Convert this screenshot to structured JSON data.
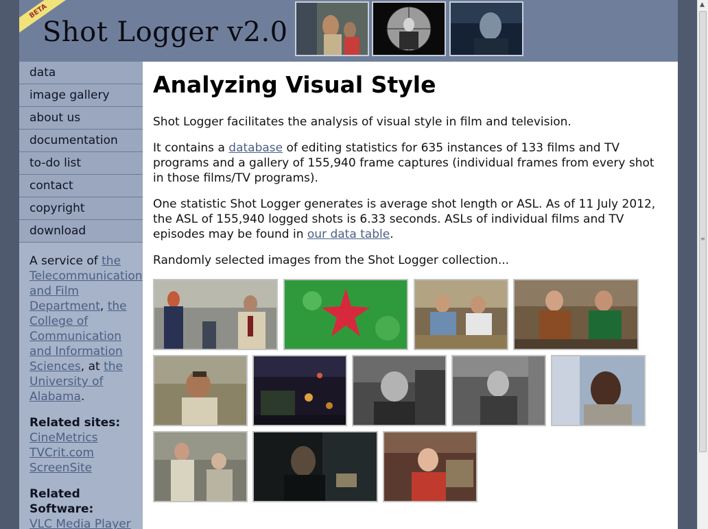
{
  "header": {
    "beta_label": "BETA",
    "logo_text": "Shot Logger v2.0"
  },
  "sidebar": {
    "nav": [
      {
        "label": "data"
      },
      {
        "label": "image gallery"
      },
      {
        "label": "about us"
      },
      {
        "label": "documentation"
      },
      {
        "label": "to-do list"
      },
      {
        "label": "contact"
      },
      {
        "label": "copyright"
      },
      {
        "label": "download"
      }
    ],
    "service": {
      "prefix": "A service of ",
      "link1": "the Telecommunication and Film Department",
      "sep1": ", ",
      "link2": "the College of Communication and Information Sciences",
      "sep2": ", at ",
      "link3": "the University of Alabama",
      "suffix": "."
    },
    "related_sites_heading": "Related sites:",
    "related_sites": [
      "CineMetrics",
      "TVCrit.com",
      "ScreenSite"
    ],
    "related_software_heading": "Related Software:",
    "related_software": [
      "VLC Media Player"
    ]
  },
  "main": {
    "title": "Analyzing Visual Style",
    "p1": "Shot Logger facilitates the analysis of visual style in film and television.",
    "p2": {
      "pre": "It contains a ",
      "link": "database",
      "post": " of editing statistics for 635 instances of 133 films and TV programs and a gallery of 155,940 frame captures (individual frames from every shot in those films/TV programs)."
    },
    "p3": {
      "pre": "One statistic Shot Logger generates is average shot length or ASL. As of 11 July 2012, the ASL of 155,940 logged shots is 6.33 seconds. ASLs of individual films and TV episodes may be found in ",
      "link": "our data table",
      "post": "."
    },
    "p4": "Randomly selected images from the Shot Logger collection..."
  },
  "colors": {
    "page_bg": "#6f7f9b",
    "sidebar_nav": "#9aa7bf",
    "sidebar_bg": "#a7b3c8",
    "link": "#4b5f85",
    "content_bg": "#ffffff"
  }
}
